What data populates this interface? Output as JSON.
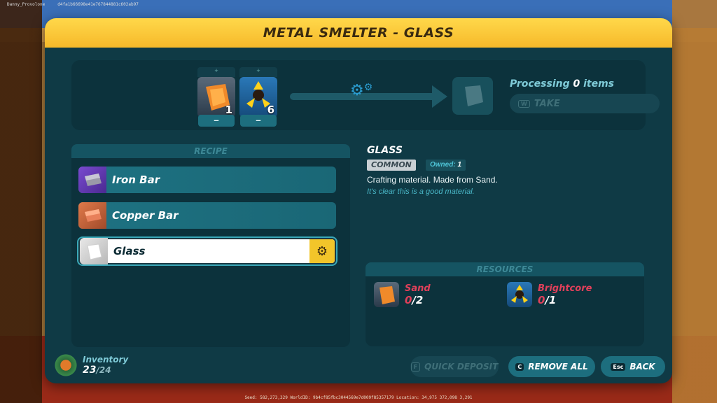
{
  "hud": {
    "player_name": "Danny_Provolone",
    "session_hash": "d4fa1b66698e41e767844881c602ab97",
    "footer": "Seed: 582,273,329   WorldID: 9b4cf85fbc3044569e7d009f85357179   Location: 34,975  372,098  3,291"
  },
  "window": {
    "title": "METAL SMELTER - GLASS"
  },
  "process": {
    "inputs": [
      {
        "name": "Sand",
        "count": "1",
        "icon": "sand-icon",
        "minus": "–"
      },
      {
        "name": "Brightcore",
        "count": "6",
        "icon": "brightcore-icon",
        "minus": "–"
      }
    ],
    "processing_prefix": "Processing",
    "processing_count": "0",
    "processing_suffix": "items",
    "take_key": "W",
    "take_label": "TAKE"
  },
  "recipe": {
    "header": "RECIPE",
    "items": [
      {
        "label": "Iron Bar",
        "icon": "iron-bar-icon"
      },
      {
        "label": "Copper Bar",
        "icon": "copper-bar-icon"
      },
      {
        "label": "Glass",
        "icon": "glass-icon",
        "selected": true
      }
    ]
  },
  "detail": {
    "title": "GLASS",
    "rarity": "COMMON",
    "owned_label": "Owned:",
    "owned_value": "1",
    "description": "Crafting material. Made from Sand.",
    "flavor": "It's clear this is a good material."
  },
  "resources": {
    "header": "RESOURCES",
    "items": [
      {
        "name": "Sand",
        "have": "0",
        "need": "/2",
        "icon": "sand-icon"
      },
      {
        "name": "Brightcore",
        "have": "0",
        "need": "/1",
        "icon": "brightcore-icon"
      }
    ]
  },
  "inventory": {
    "label": "Inventory",
    "used": "23",
    "capacity": "/24"
  },
  "buttons": {
    "quick_deposit": {
      "key": "F",
      "label": "QUICK DEPOSIT"
    },
    "remove_all": {
      "key": "C",
      "label": "REMOVE ALL"
    },
    "back": {
      "key": "Esc",
      "label": "BACK"
    }
  },
  "colors": {
    "title_bar": "#f6b92a",
    "panel": "#0f3a45",
    "accent_teal": "#1d6e7e",
    "deficit_red": "#e0405a"
  }
}
